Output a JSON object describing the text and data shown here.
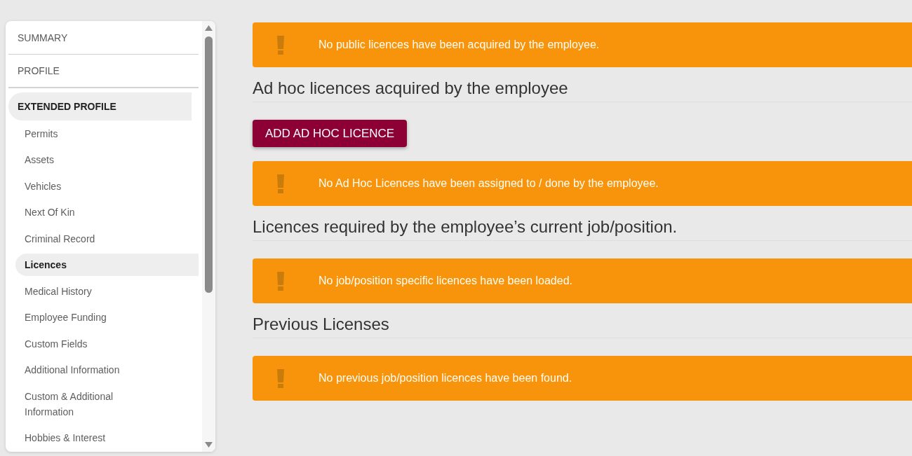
{
  "sidebar": {
    "items": [
      {
        "label": "SUMMARY",
        "selected": false
      },
      {
        "label": "PROFILE",
        "selected": false
      },
      {
        "label": "EXTENDED PROFILE",
        "selected": true,
        "children": [
          {
            "label": "Permits",
            "selected": false
          },
          {
            "label": "Assets",
            "selected": false
          },
          {
            "label": "Vehicles",
            "selected": false
          },
          {
            "label": "Next Of Kin",
            "selected": false
          },
          {
            "label": "Criminal Record",
            "selected": false
          },
          {
            "label": "Licences",
            "selected": true
          },
          {
            "label": "Medical History",
            "selected": false
          },
          {
            "label": "Employee Funding",
            "selected": false
          },
          {
            "label": "Custom Fields",
            "selected": false
          },
          {
            "label": "Additional Information",
            "selected": false
          },
          {
            "label": "Custom & Additional Information",
            "selected": false
          },
          {
            "label": "Hobbies & Interest",
            "selected": false
          }
        ]
      }
    ]
  },
  "content": [
    {
      "kind": "alert",
      "message": "No public licences have been acquired by the employee."
    },
    {
      "kind": "heading",
      "title": "Ad hoc licences acquired by the employee"
    },
    {
      "kind": "button",
      "label": "ADD AD HOC LICENCE"
    },
    {
      "kind": "alert",
      "message": "No Ad Hoc Licences have been assigned to / done by the employee."
    },
    {
      "kind": "heading",
      "title": "Licences required by the employee’s current job/position."
    },
    {
      "kind": "alert",
      "message": "No job/position specific licences have been loaded."
    },
    {
      "kind": "heading",
      "title": "Previous Licenses"
    },
    {
      "kind": "alert",
      "message": "No previous job/position licences have been found."
    }
  ]
}
